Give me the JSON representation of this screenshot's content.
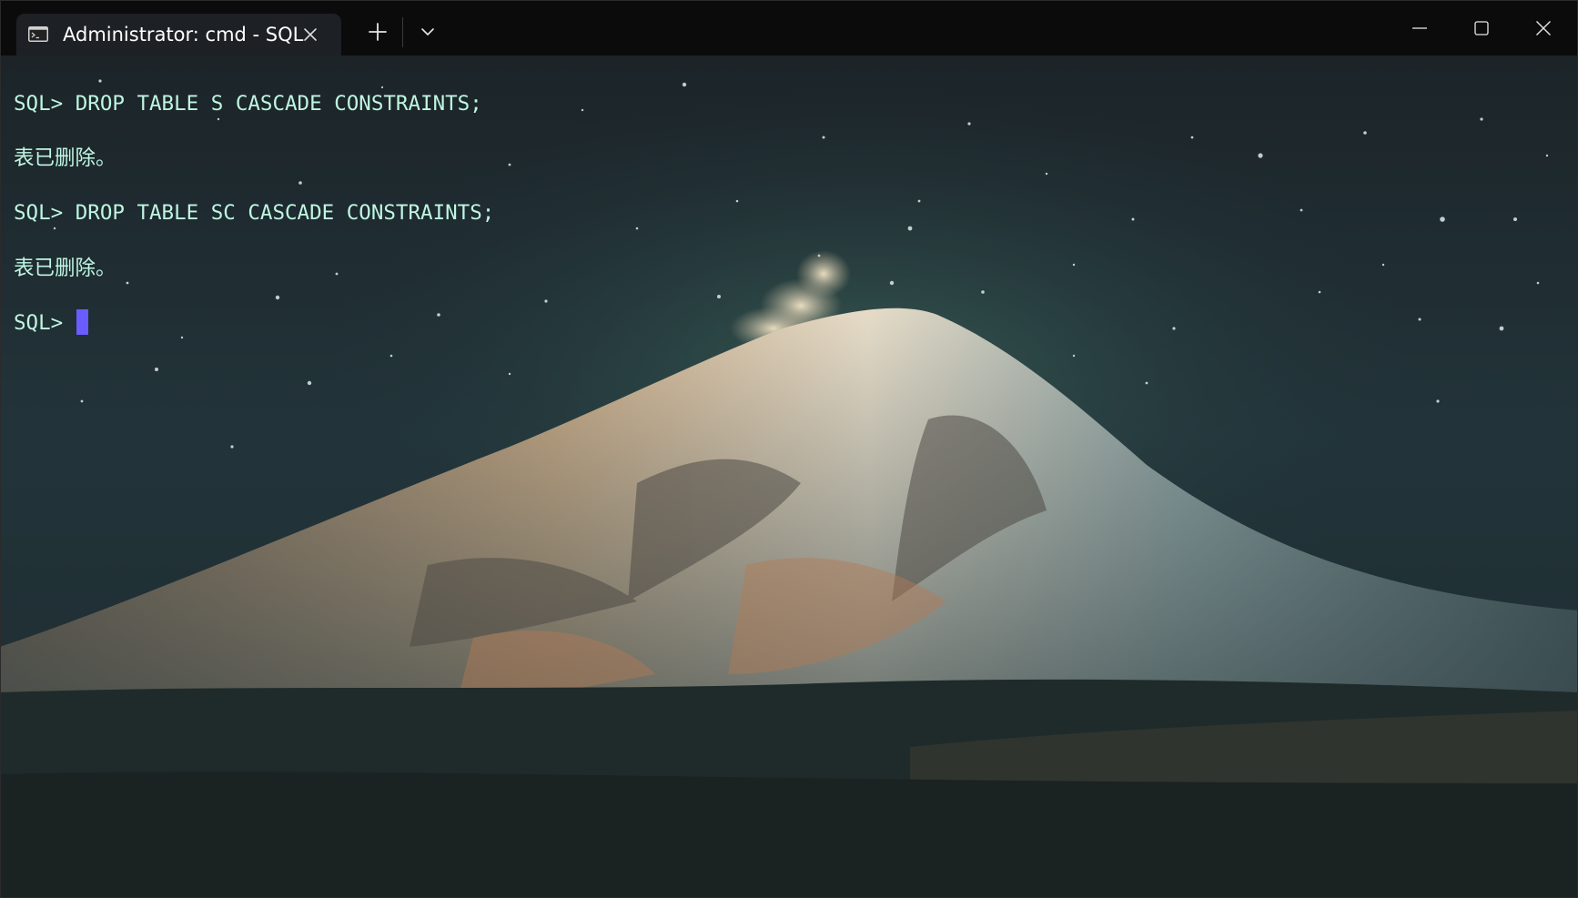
{
  "window": {
    "tab": {
      "title": "Administrator: cmd - SQL",
      "icon": "terminal-icon",
      "close_icon": "close-icon"
    },
    "new_tab_icon": "plus-icon",
    "dropdown_icon": "chevron-down-icon",
    "controls": {
      "minimize_icon": "minimize-icon",
      "maximize_icon": "maximize-icon",
      "close_icon": "close-icon"
    }
  },
  "terminal": {
    "lines": [
      "SQL> DROP TABLE S CASCADE CONSTRAINTS;",
      "表已删除。",
      "SQL> DROP TABLE SC CASCADE CONSTRAINTS;",
      "表已删除。"
    ],
    "prompt": "SQL> ",
    "background_image": "starry night over snow-capped volcano",
    "colors": {
      "text": "#bff6e2",
      "cursor": "#6b5cff",
      "titlebar": "#0b0b0c",
      "tab": "#1d2024"
    }
  }
}
